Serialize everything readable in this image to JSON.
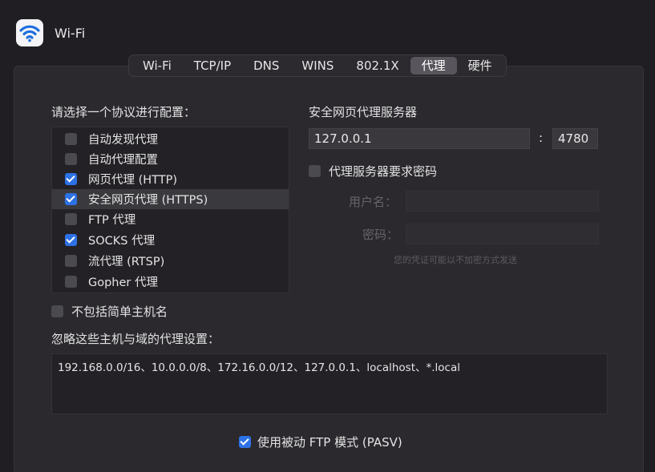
{
  "window": {
    "title": "Wi-Fi",
    "icon": "wifi-icon"
  },
  "tabs": [
    {
      "label": "Wi-Fi",
      "active": false
    },
    {
      "label": "TCP/IP",
      "active": false
    },
    {
      "label": "DNS",
      "active": false
    },
    {
      "label": "WINS",
      "active": false
    },
    {
      "label": "802.1X",
      "active": false
    },
    {
      "label": "代理",
      "active": true
    },
    {
      "label": "硬件",
      "active": false
    }
  ],
  "protocol": {
    "heading": "请选择一个协议进行配置：",
    "items": [
      {
        "label": "自动发现代理",
        "checked": false,
        "selected": false
      },
      {
        "label": "自动代理配置",
        "checked": false,
        "selected": false
      },
      {
        "label": "网页代理 (HTTP)",
        "checked": true,
        "selected": false
      },
      {
        "label": "安全网页代理 (HTTPS)",
        "checked": true,
        "selected": true
      },
      {
        "label": "FTP 代理",
        "checked": false,
        "selected": false
      },
      {
        "label": "SOCKS 代理",
        "checked": true,
        "selected": false
      },
      {
        "label": "流代理 (RTSP)",
        "checked": false,
        "selected": false
      },
      {
        "label": "Gopher 代理",
        "checked": false,
        "selected": false
      }
    ]
  },
  "server": {
    "heading": "安全网页代理服务器",
    "host": "127.0.0.1",
    "separator": ":",
    "port": "4780",
    "require_password": {
      "label": "代理服务器要求密码",
      "checked": false
    },
    "username_label": "用户名：",
    "password_label": "密码：",
    "username_value": "",
    "password_value": "",
    "note": "您的凭证可能以不加密方式发送"
  },
  "exclude_simple": {
    "label": "不包括简单主机名",
    "checked": false
  },
  "bypass": {
    "heading": "忽略这些主机与域的代理设置：",
    "value": "192.168.0.0/16、10.0.0.0/8、172.16.0.0/12、127.0.0.1、localhost、*.local"
  },
  "pasv": {
    "label": "使用被动 FTP 模式 (PASV)",
    "checked": true
  },
  "colors": {
    "accent": "#2d71e6",
    "background": "#201e23",
    "panel": "#2b292e"
  }
}
